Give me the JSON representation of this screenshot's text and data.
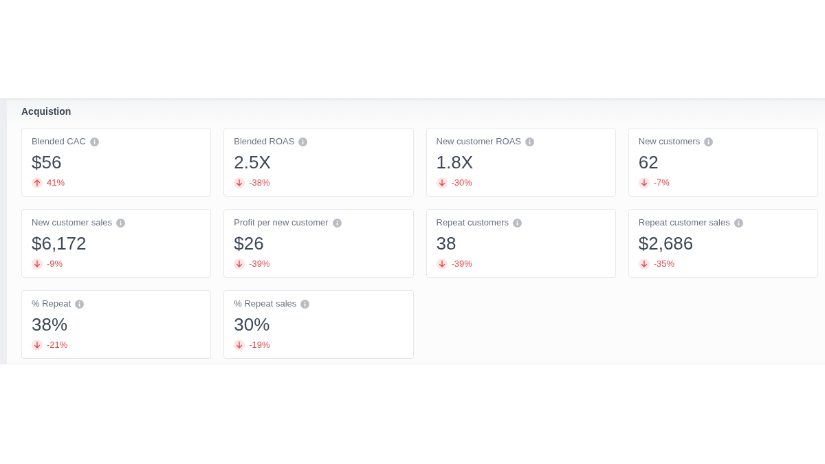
{
  "section": {
    "title": "Acquistion"
  },
  "metrics": [
    {
      "label": "Blended CAC",
      "value": "$56",
      "change": "41%",
      "up": true
    },
    {
      "label": "Blended ROAS",
      "value": "2.5X",
      "change": "-38%",
      "up": false
    },
    {
      "label": "New customer ROAS",
      "value": "1.8X",
      "change": "-30%",
      "up": false
    },
    {
      "label": "New customers",
      "value": "62",
      "change": "-7%",
      "up": false
    },
    {
      "label": "New customer sales",
      "value": "$6,172",
      "change": "-9%",
      "up": false
    },
    {
      "label": "Profit per new customer",
      "value": "$26",
      "change": "-39%",
      "up": false
    },
    {
      "label": "Repeat customers",
      "value": "38",
      "change": "-39%",
      "up": false
    },
    {
      "label": "Repeat customer sales",
      "value": "$2,686",
      "change": "-35%",
      "up": false
    },
    {
      "label": "% Repeat",
      "value": "38%",
      "change": "-21%",
      "up": false
    },
    {
      "label": "% Repeat sales",
      "value": "30%",
      "change": "-19%",
      "up": false
    }
  ]
}
